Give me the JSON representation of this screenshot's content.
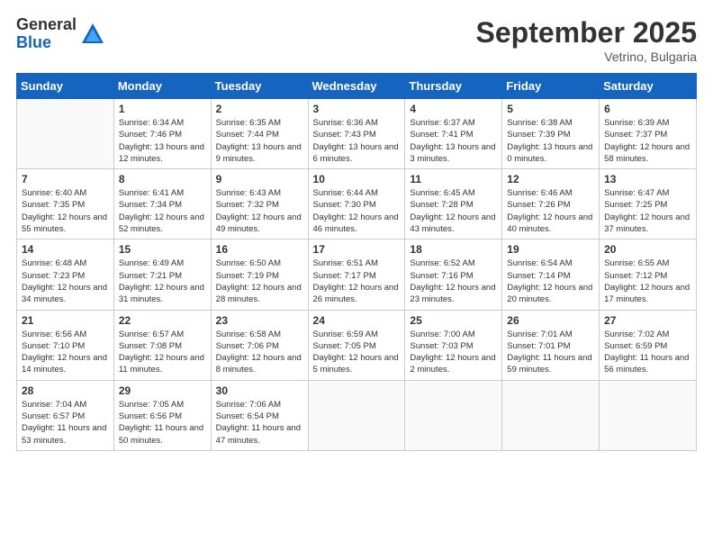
{
  "logo": {
    "general": "General",
    "blue": "Blue"
  },
  "header": {
    "month": "September 2025",
    "location": "Vetrino, Bulgaria"
  },
  "days_of_week": [
    "Sunday",
    "Monday",
    "Tuesday",
    "Wednesday",
    "Thursday",
    "Friday",
    "Saturday"
  ],
  "weeks": [
    [
      {
        "day": "",
        "empty": true
      },
      {
        "day": "1",
        "sunrise": "Sunrise: 6:34 AM",
        "sunset": "Sunset: 7:46 PM",
        "daylight": "Daylight: 13 hours and 12 minutes."
      },
      {
        "day": "2",
        "sunrise": "Sunrise: 6:35 AM",
        "sunset": "Sunset: 7:44 PM",
        "daylight": "Daylight: 13 hours and 9 minutes."
      },
      {
        "day": "3",
        "sunrise": "Sunrise: 6:36 AM",
        "sunset": "Sunset: 7:43 PM",
        "daylight": "Daylight: 13 hours and 6 minutes."
      },
      {
        "day": "4",
        "sunrise": "Sunrise: 6:37 AM",
        "sunset": "Sunset: 7:41 PM",
        "daylight": "Daylight: 13 hours and 3 minutes."
      },
      {
        "day": "5",
        "sunrise": "Sunrise: 6:38 AM",
        "sunset": "Sunset: 7:39 PM",
        "daylight": "Daylight: 13 hours and 0 minutes."
      },
      {
        "day": "6",
        "sunrise": "Sunrise: 6:39 AM",
        "sunset": "Sunset: 7:37 PM",
        "daylight": "Daylight: 12 hours and 58 minutes."
      }
    ],
    [
      {
        "day": "7",
        "sunrise": "Sunrise: 6:40 AM",
        "sunset": "Sunset: 7:35 PM",
        "daylight": "Daylight: 12 hours and 55 minutes."
      },
      {
        "day": "8",
        "sunrise": "Sunrise: 6:41 AM",
        "sunset": "Sunset: 7:34 PM",
        "daylight": "Daylight: 12 hours and 52 minutes."
      },
      {
        "day": "9",
        "sunrise": "Sunrise: 6:43 AM",
        "sunset": "Sunset: 7:32 PM",
        "daylight": "Daylight: 12 hours and 49 minutes."
      },
      {
        "day": "10",
        "sunrise": "Sunrise: 6:44 AM",
        "sunset": "Sunset: 7:30 PM",
        "daylight": "Daylight: 12 hours and 46 minutes."
      },
      {
        "day": "11",
        "sunrise": "Sunrise: 6:45 AM",
        "sunset": "Sunset: 7:28 PM",
        "daylight": "Daylight: 12 hours and 43 minutes."
      },
      {
        "day": "12",
        "sunrise": "Sunrise: 6:46 AM",
        "sunset": "Sunset: 7:26 PM",
        "daylight": "Daylight: 12 hours and 40 minutes."
      },
      {
        "day": "13",
        "sunrise": "Sunrise: 6:47 AM",
        "sunset": "Sunset: 7:25 PM",
        "daylight": "Daylight: 12 hours and 37 minutes."
      }
    ],
    [
      {
        "day": "14",
        "sunrise": "Sunrise: 6:48 AM",
        "sunset": "Sunset: 7:23 PM",
        "daylight": "Daylight: 12 hours and 34 minutes."
      },
      {
        "day": "15",
        "sunrise": "Sunrise: 6:49 AM",
        "sunset": "Sunset: 7:21 PM",
        "daylight": "Daylight: 12 hours and 31 minutes."
      },
      {
        "day": "16",
        "sunrise": "Sunrise: 6:50 AM",
        "sunset": "Sunset: 7:19 PM",
        "daylight": "Daylight: 12 hours and 28 minutes."
      },
      {
        "day": "17",
        "sunrise": "Sunrise: 6:51 AM",
        "sunset": "Sunset: 7:17 PM",
        "daylight": "Daylight: 12 hours and 26 minutes."
      },
      {
        "day": "18",
        "sunrise": "Sunrise: 6:52 AM",
        "sunset": "Sunset: 7:16 PM",
        "daylight": "Daylight: 12 hours and 23 minutes."
      },
      {
        "day": "19",
        "sunrise": "Sunrise: 6:54 AM",
        "sunset": "Sunset: 7:14 PM",
        "daylight": "Daylight: 12 hours and 20 minutes."
      },
      {
        "day": "20",
        "sunrise": "Sunrise: 6:55 AM",
        "sunset": "Sunset: 7:12 PM",
        "daylight": "Daylight: 12 hours and 17 minutes."
      }
    ],
    [
      {
        "day": "21",
        "sunrise": "Sunrise: 6:56 AM",
        "sunset": "Sunset: 7:10 PM",
        "daylight": "Daylight: 12 hours and 14 minutes."
      },
      {
        "day": "22",
        "sunrise": "Sunrise: 6:57 AM",
        "sunset": "Sunset: 7:08 PM",
        "daylight": "Daylight: 12 hours and 11 minutes."
      },
      {
        "day": "23",
        "sunrise": "Sunrise: 6:58 AM",
        "sunset": "Sunset: 7:06 PM",
        "daylight": "Daylight: 12 hours and 8 minutes."
      },
      {
        "day": "24",
        "sunrise": "Sunrise: 6:59 AM",
        "sunset": "Sunset: 7:05 PM",
        "daylight": "Daylight: 12 hours and 5 minutes."
      },
      {
        "day": "25",
        "sunrise": "Sunrise: 7:00 AM",
        "sunset": "Sunset: 7:03 PM",
        "daylight": "Daylight: 12 hours and 2 minutes."
      },
      {
        "day": "26",
        "sunrise": "Sunrise: 7:01 AM",
        "sunset": "Sunset: 7:01 PM",
        "daylight": "Daylight: 11 hours and 59 minutes."
      },
      {
        "day": "27",
        "sunrise": "Sunrise: 7:02 AM",
        "sunset": "Sunset: 6:59 PM",
        "daylight": "Daylight: 11 hours and 56 minutes."
      }
    ],
    [
      {
        "day": "28",
        "sunrise": "Sunrise: 7:04 AM",
        "sunset": "Sunset: 6:57 PM",
        "daylight": "Daylight: 11 hours and 53 minutes."
      },
      {
        "day": "29",
        "sunrise": "Sunrise: 7:05 AM",
        "sunset": "Sunset: 6:56 PM",
        "daylight": "Daylight: 11 hours and 50 minutes."
      },
      {
        "day": "30",
        "sunrise": "Sunrise: 7:06 AM",
        "sunset": "Sunset: 6:54 PM",
        "daylight": "Daylight: 11 hours and 47 minutes."
      },
      {
        "day": "",
        "empty": true
      },
      {
        "day": "",
        "empty": true
      },
      {
        "day": "",
        "empty": true
      },
      {
        "day": "",
        "empty": true
      }
    ]
  ]
}
